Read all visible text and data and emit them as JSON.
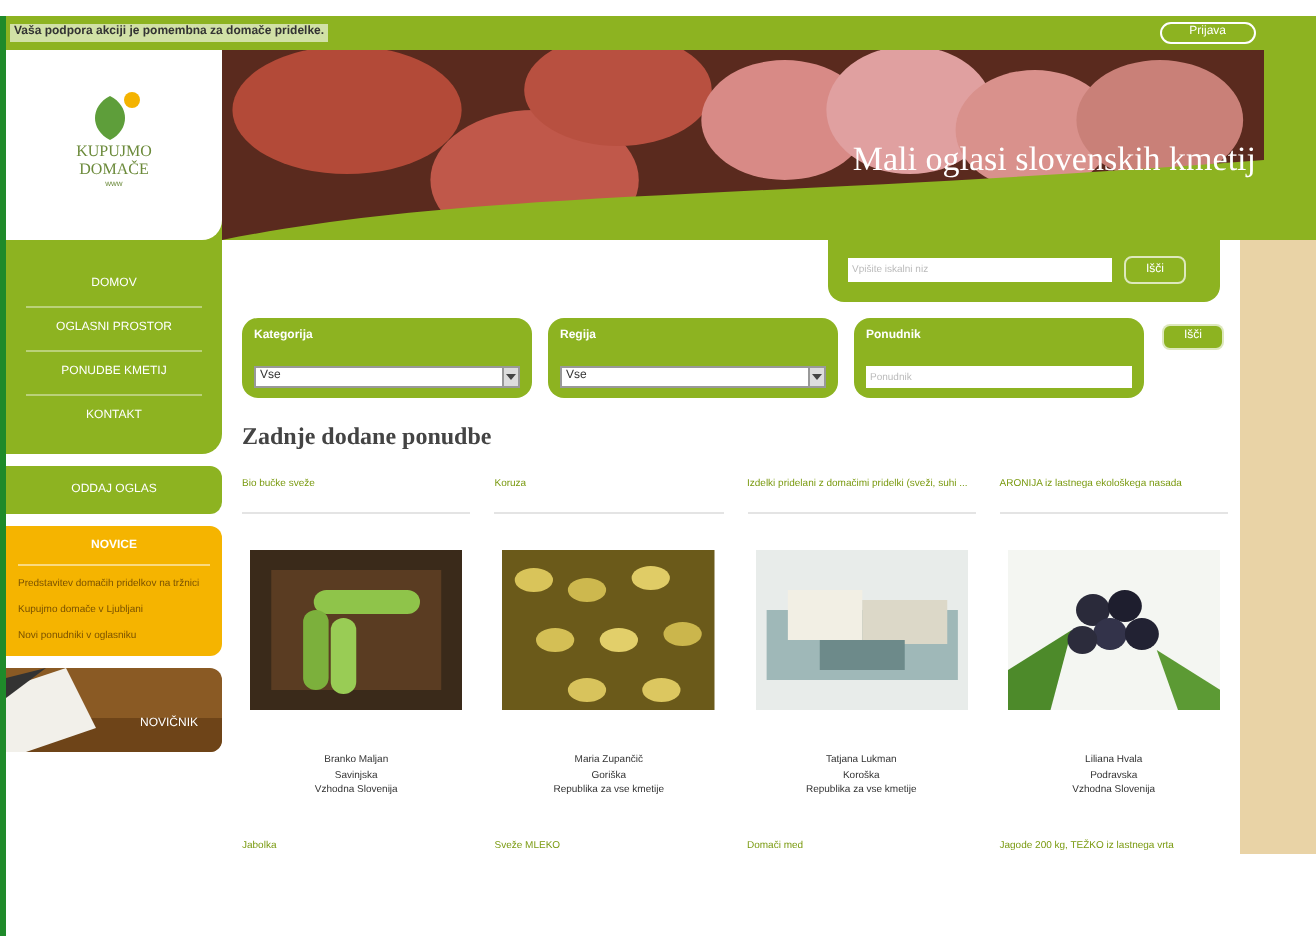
{
  "top_bar": {
    "notice": "Vaša podpora akciji je pomembna za domače pridelke.",
    "login_button": "Prijava"
  },
  "logo": {
    "line_1": "KUPUJMO",
    "line_2": "DOMAČE",
    "tagline": "www"
  },
  "banner": {
    "title": "Mali oglasi slovenskih kmetij"
  },
  "search": {
    "placeholder": "Vpišite iskalni niz",
    "button": "Išči"
  },
  "menu": [
    "DOMOV",
    "OGLASNI PROSTOR",
    "PONUDBE KMETIJ",
    "KONTAKT"
  ],
  "post_ad_button": "ODDAJ OGLAS",
  "news": {
    "title": "NOVICE",
    "items": [
      "Predstavitev domačih pridelkov na tržnici",
      "Kupujmo domače v Ljubljani",
      "Novi ponudniki v oglasniku"
    ]
  },
  "newsletter": {
    "label": "NOVIČNIK"
  },
  "filters": {
    "fields": [
      {
        "kind": "select",
        "label": "Kategorija",
        "value": "Vse"
      },
      {
        "kind": "select",
        "label": "Regija",
        "value": "Vse"
      },
      {
        "kind": "text",
        "label": "Ponudnik",
        "placeholder": "Ponudnik"
      }
    ],
    "button": "Išči"
  },
  "heading": "Zadnje dodane ponudbe",
  "offers": [
    {
      "title": "Bio bučke sveže",
      "seller": "Branko Maljan",
      "region": "Savinjska",
      "area": "Vzhodna Slovenija"
    },
    {
      "title": "Koruza",
      "seller": "Maria Zupančič",
      "region": "Goriška",
      "area": "Republika za vse kmetije"
    },
    {
      "title": "Izdelki pridelani z domačimi pridelki (sveži, suhi ...",
      "seller": "Tatjana Lukman",
      "region": "Koroška",
      "area": "Republika za vse kmetije"
    },
    {
      "title": "ARONIJA iz lastnega ekološkega nasada",
      "seller": "Liliana Hvala",
      "region": "Podravska",
      "area": "Vzhodna Slovenija"
    }
  ],
  "more_offers": [
    "Jabolka",
    "Sveže MLEKO",
    "Domači med",
    "Jagode 200 kg, TEŽKO iz lastnega vrta"
  ]
}
